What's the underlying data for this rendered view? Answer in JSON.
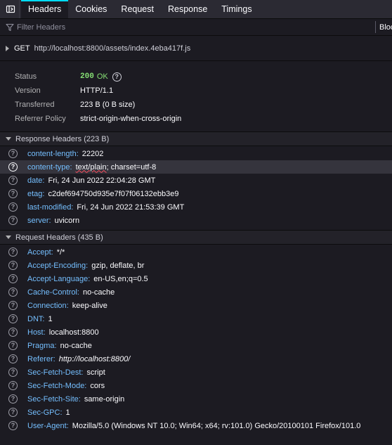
{
  "tabs": [
    "Headers",
    "Cookies",
    "Request",
    "Response",
    "Timings"
  ],
  "filter": {
    "placeholder": "Filter Headers",
    "block_label": "Block"
  },
  "request": {
    "method": "GET",
    "url": "http://localhost:8800/assets/index.4eba417f.js"
  },
  "summary": {
    "status_label": "Status",
    "status_code": "200",
    "status_text": "OK",
    "version_label": "Version",
    "version": "HTTP/1.1",
    "transferred_label": "Transferred",
    "transferred": "223 B (0 B size)",
    "referrer_label": "Referrer Policy",
    "referrer": "strict-origin-when-cross-origin"
  },
  "response_headers": {
    "title": "Response Headers (223 B)",
    "rows": [
      {
        "name": "content-length:",
        "value": "22202"
      },
      {
        "name": "content-type:",
        "value_part1": "text/plain",
        "value_part2": "; charset=utf-8"
      },
      {
        "name": "date:",
        "value": "Fri, 24 Jun 2022 22:04:28 GMT"
      },
      {
        "name": "etag:",
        "value": "c2def694750d935e7f07f06132ebb3e9"
      },
      {
        "name": "last-modified:",
        "value": "Fri, 24 Jun 2022 21:53:39 GMT"
      },
      {
        "name": "server:",
        "value": "uvicorn"
      }
    ]
  },
  "request_headers": {
    "title": "Request Headers (435 B)",
    "rows": [
      {
        "name": "Accept:",
        "value": "*/*"
      },
      {
        "name": "Accept-Encoding:",
        "value": "gzip, deflate, br"
      },
      {
        "name": "Accept-Language:",
        "value": "en-US,en;q=0.5"
      },
      {
        "name": "Cache-Control:",
        "value": "no-cache"
      },
      {
        "name": "Connection:",
        "value": "keep-alive"
      },
      {
        "name": "DNT:",
        "value": "1"
      },
      {
        "name": "Host:",
        "value": "localhost:8800"
      },
      {
        "name": "Pragma:",
        "value": "no-cache"
      },
      {
        "name": "Referer:",
        "value": "http://localhost:8800/"
      },
      {
        "name": "Sec-Fetch-Dest:",
        "value": "script"
      },
      {
        "name": "Sec-Fetch-Mode:",
        "value": "cors"
      },
      {
        "name": "Sec-Fetch-Site:",
        "value": "same-origin"
      },
      {
        "name": "Sec-GPC:",
        "value": "1"
      },
      {
        "name": "User-Agent:",
        "value": "Mozilla/5.0 (Windows NT 10.0; Win64; x64; rv:101.0) Gecko/20100101 Firefox/101.0"
      }
    ]
  },
  "icons": {
    "panel_toggle": "panel-toggle-icon",
    "filter": "filter-icon",
    "help": "help-icon",
    "help_glyph": "?"
  },
  "colors": {
    "accent": "#00ddff",
    "status_ok": "#86de74",
    "header_name": "#75bfff",
    "squiggle": "#ff4f5e"
  }
}
